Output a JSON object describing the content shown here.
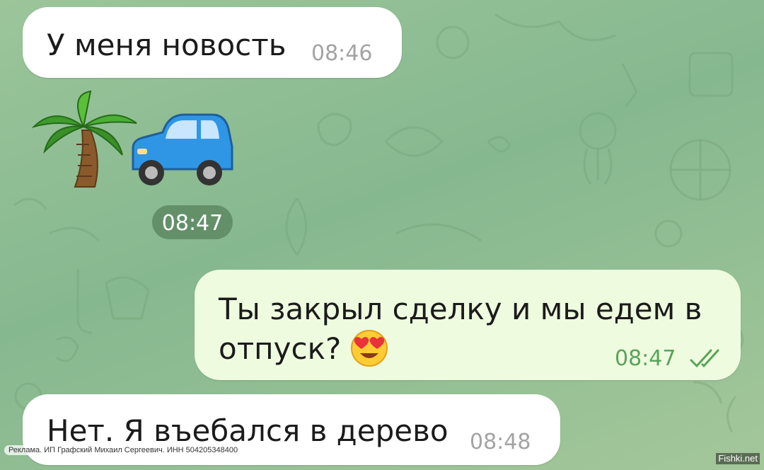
{
  "chat": {
    "messages": [
      {
        "direction": "incoming",
        "text": "У меня новость",
        "time": "08:46"
      },
      {
        "direction": "incoming",
        "type": "emoji",
        "emojis": [
          "palm-tree",
          "automobile"
        ],
        "time": "08:47"
      },
      {
        "direction": "outgoing",
        "lines": [
          "Ты закрыл сделку и мы едем в",
          "отпуск?"
        ],
        "emoji": "heart-eyes",
        "time": "08:47",
        "status": "read"
      },
      {
        "direction": "incoming",
        "text": "Нет. Я въебался в дерево",
        "time": "08:48"
      }
    ]
  },
  "ad": {
    "text": "Реклама. ИП Графский Михаил Сергеевич. ИНН 504205348400"
  },
  "watermark": {
    "text": "Fishki.net"
  },
  "colors": {
    "incoming_bubble": "#ffffff",
    "outgoing_bubble": "#eefbdf",
    "outgoing_time": "#5aa35a",
    "background": "#93bf93"
  }
}
